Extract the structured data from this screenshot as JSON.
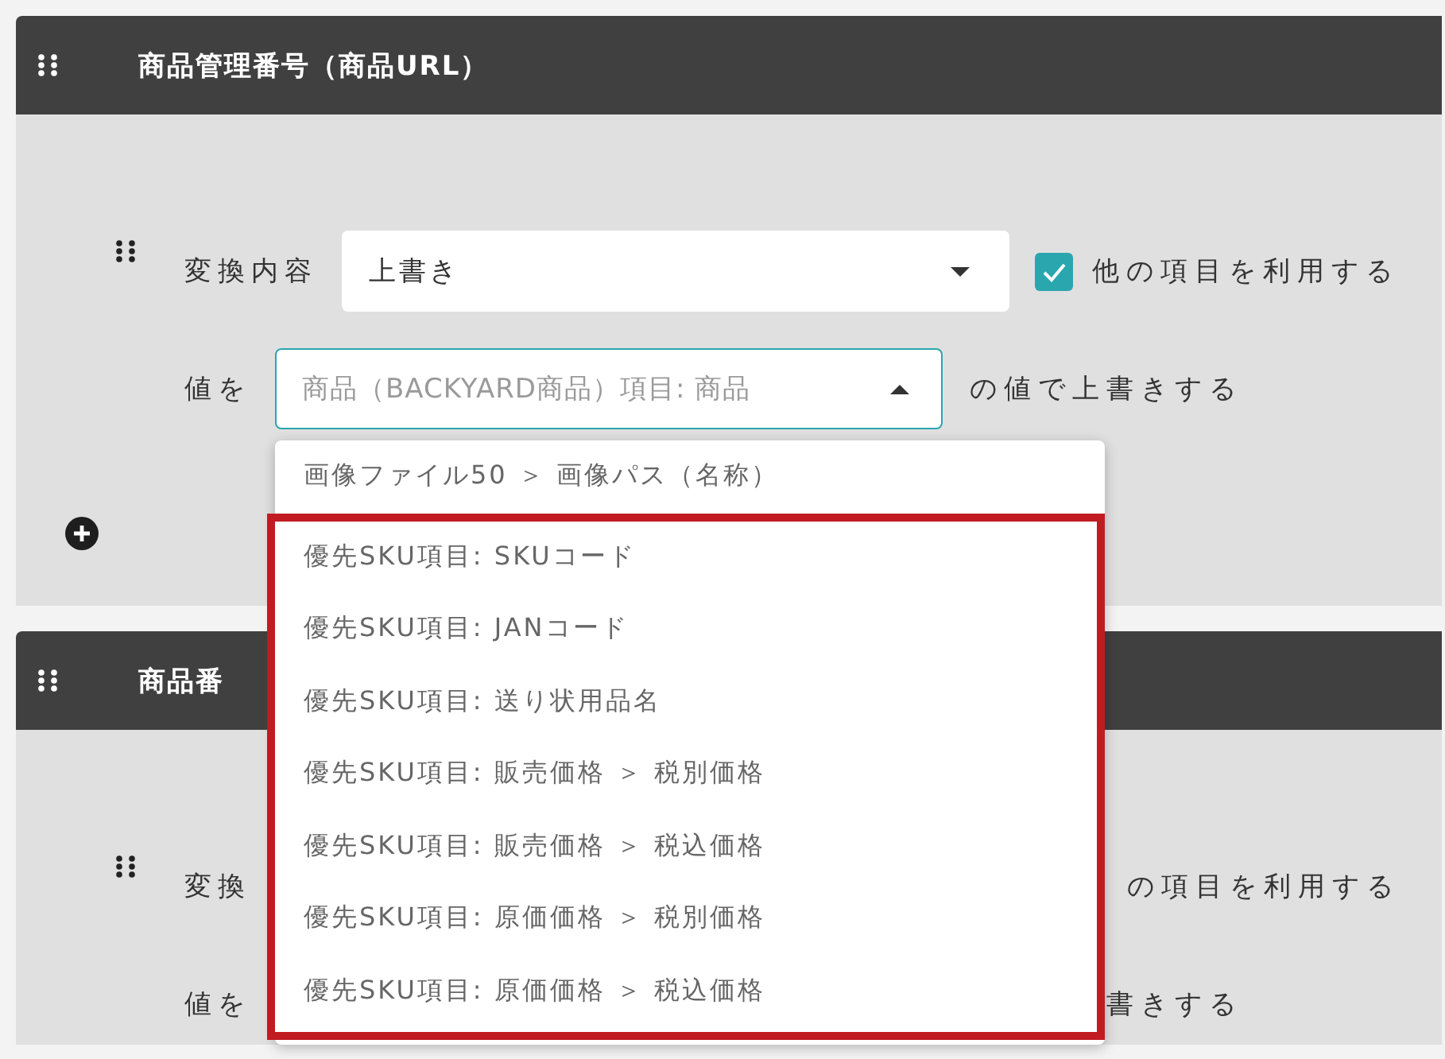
{
  "sections": [
    {
      "title": "商品管理番号（商品URL）",
      "add_button": true,
      "rows": [
        {
          "kind": "convert",
          "label": "変換内容",
          "select": {
            "value": "上書き"
          },
          "option": {
            "label": "他の項目を利用する",
            "checked": true
          }
        },
        {
          "kind": "value",
          "label": "値を",
          "field": {
            "placeholder": "商品（BACKYARD商品）項目: 商品",
            "expanded": true,
            "options": [
              "画像ファイル50 ＞ 画像パス（名称）"
            ],
            "highlighted_options": [
              "優先SKU項目: SKUコード",
              "優先SKU項目: JANコード",
              "優先SKU項目: 送り状用品名",
              "優先SKU項目: 販売価格 ＞ 税別価格",
              "優先SKU項目: 販売価格 ＞ 税込価格",
              "優先SKU項目: 原価価格 ＞ 税別価格",
              "優先SKU項目: 原価価格 ＞ 税込価格"
            ]
          },
          "suffix": "の値で上書きする"
        }
      ]
    },
    {
      "title": "商品番",
      "rows": [
        {
          "kind": "convert",
          "label": "変換",
          "tail_text": "の項目を利用する"
        },
        {
          "kind": "value",
          "label": "値を",
          "tail_text": "書きする"
        }
      ]
    }
  ]
}
